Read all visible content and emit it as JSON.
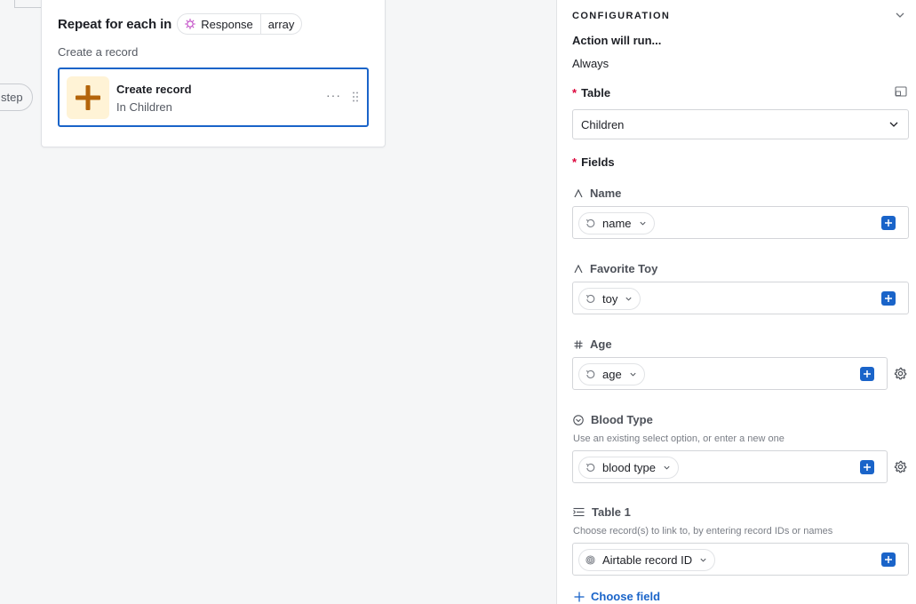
{
  "canvas": {
    "step_pill_label": "step",
    "repeat": {
      "title": "Repeat for each in",
      "token_source": "Response",
      "token_type": "array",
      "subtitle": "Create a record"
    },
    "action": {
      "title": "Create record",
      "subtitle": "In Children",
      "more": "···"
    }
  },
  "panel": {
    "section_title": "CONFIGURATION",
    "runs_label": "Action will run...",
    "runs_value": "Always",
    "required_marker": "*",
    "table": {
      "label": "Table",
      "value": "Children"
    },
    "fields_label": "Fields",
    "fields": [
      {
        "label": "Name",
        "icon": "text-icon",
        "hint": "",
        "pill": "name",
        "has_gear": false
      },
      {
        "label": "Favorite Toy",
        "icon": "text-icon",
        "hint": "",
        "pill": "toy",
        "has_gear": false
      },
      {
        "label": "Age",
        "icon": "number-icon",
        "hint": "",
        "pill": "age",
        "has_gear": true
      },
      {
        "label": "Blood Type",
        "icon": "single-select-icon",
        "hint": "Use an existing select option, or enter a new one",
        "pill": "blood type",
        "has_gear": true
      },
      {
        "label": "Table 1",
        "icon": "linked-record-icon",
        "hint": "Choose record(s) to link to, by entering record IDs or names",
        "pill": "Airtable record ID",
        "has_gear": false
      }
    ],
    "choose_field": "Choose field"
  },
  "colors": {
    "accent_blue": "#1a64c9",
    "required_red": "#dc043b",
    "action_icon_bg": "#fff3d6",
    "action_icon_fg": "#b4640a",
    "canvas_bg": "#f5f6f7"
  }
}
